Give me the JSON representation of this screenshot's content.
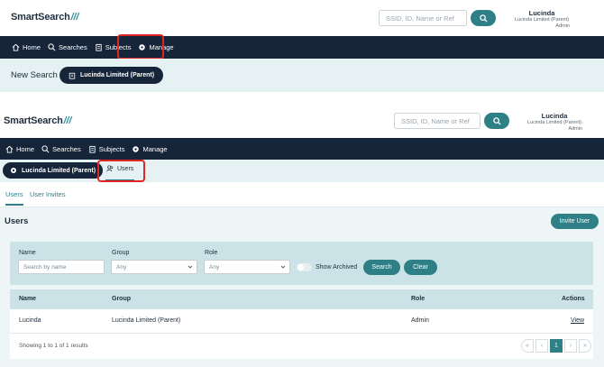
{
  "top": {
    "logo_text": "SmartSearch",
    "logo_slashes": "///",
    "search_placeholder": "SSID, ID, Name or Ref",
    "user": {
      "name": "Lucinda",
      "org": "Lucinda Limited (Parent)",
      "role": "Admin"
    },
    "nav": [
      {
        "label": "Home",
        "icon": "home-icon"
      },
      {
        "label": "Searches",
        "icon": "search-icon"
      },
      {
        "label": "Subjects",
        "icon": "clipboard-icon"
      },
      {
        "label": "Manage",
        "icon": "gear-icon"
      }
    ],
    "page_title": "New Search",
    "org_pill": "Lucinda Limited (Parent)"
  },
  "bottom": {
    "logo_text": "SmartSearch",
    "logo_slashes": "///",
    "search_placeholder": "SSID, ID, Name or Ref",
    "user": {
      "name": "Lucinda",
      "org": "Lucinda Limited (Parent)",
      "role": "Admin"
    },
    "nav": [
      {
        "label": "Home",
        "icon": "home-icon"
      },
      {
        "label": "Searches",
        "icon": "search-icon"
      },
      {
        "label": "Subjects",
        "icon": "clipboard-icon"
      },
      {
        "label": "Manage",
        "icon": "gear-icon"
      }
    ],
    "org_pill": "Lucinda Limited (Parent)",
    "users_tab": "Users",
    "tabs": [
      {
        "label": "Users",
        "active": true
      },
      {
        "label": "User Invites",
        "active": false
      }
    ],
    "section_title": "Users",
    "invite_button": "Invite User",
    "filters": {
      "name_label": "Name",
      "name_placeholder": "Search by name",
      "group_label": "Group",
      "group_value": "Any",
      "role_label": "Role",
      "role_value": "Any",
      "show_archived": "Show Archived",
      "search_button": "Search",
      "clear_button": "Clear"
    },
    "table": {
      "headers": [
        "Name",
        "Group",
        "Role",
        "Actions"
      ],
      "rows": [
        {
          "name": "Lucinda",
          "group": "Lucinda Limited (Parent)",
          "role": "Admin",
          "action": "View"
        }
      ],
      "footer": "Showing 1 to 1 of 1 results",
      "pagination": {
        "first": "«",
        "prev": "‹",
        "current": "1",
        "next": "›",
        "last": "»"
      }
    }
  },
  "colors": {
    "navy": "#16253a",
    "teal": "#2f7f86",
    "light_teal": "#cbe3e7",
    "highlight": "#e02525"
  }
}
